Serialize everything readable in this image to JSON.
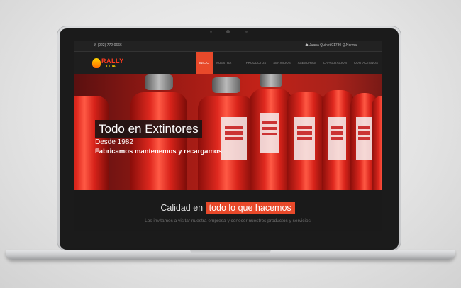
{
  "topbar": {
    "phone": "✆ (022) 772-0666",
    "address": "☗ Juana Quinet 01780 Q.Normal"
  },
  "logo": {
    "line1": "RALLY",
    "line2": "LTDA"
  },
  "nav": {
    "items": [
      {
        "label": "INICIO",
        "active": true
      },
      {
        "label": "NUESTRA EMPRESA",
        "active": false
      },
      {
        "label": "PRODUCTOS",
        "active": false
      },
      {
        "label": "SERVICIOS",
        "active": false
      },
      {
        "label": "ASESORIAS",
        "active": false
      },
      {
        "label": "CAPACITACION",
        "active": false
      },
      {
        "label": "CONTACTENOS",
        "active": false
      }
    ]
  },
  "hero": {
    "title": "Todo en Extintores",
    "since": "Desde 1982",
    "tagline": "Fabricamos mantenemos y recargamos"
  },
  "section": {
    "heading_prefix": "Calidad en",
    "heading_highlight": "todo lo que hacemos",
    "subtext": "Los invitamos a visitar nuestra empresa y conocer nuestros productos y servicios"
  },
  "colors": {
    "accent": "#e8492a",
    "background": "#1a1a1a"
  }
}
